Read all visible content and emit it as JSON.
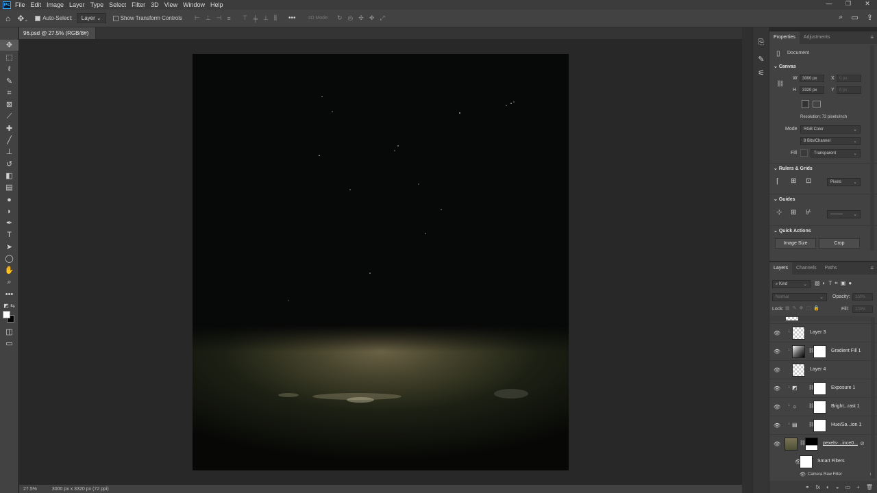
{
  "menubar": {
    "logo": "Ps",
    "items": [
      "File",
      "Edit",
      "Image",
      "Layer",
      "Type",
      "Select",
      "Filter",
      "3D",
      "View",
      "Window",
      "Help"
    ],
    "window_controls": [
      "—",
      "❐",
      "✕"
    ]
  },
  "options_bar": {
    "auto_select_label": "Auto-Select:",
    "auto_select_target": "Layer",
    "show_transform_label": "Show Transform Controls",
    "more": "•••",
    "three_d_mode": "3D Mode:"
  },
  "document": {
    "tab_title": "96.psd @ 27.5% (RGB/8#) *",
    "close": "×"
  },
  "status": {
    "zoom": "27.5%",
    "info": "3000 px x 3320 px (72 ppi)"
  },
  "properties": {
    "tabs": [
      "Properties",
      "Adjustments"
    ],
    "document_label": "Document",
    "canvas_header": "Canvas",
    "w_label": "W",
    "w_value": "3000 px",
    "h_label": "H",
    "h_value": "3320 px",
    "x_label": "X",
    "y_label": "Y",
    "x_value": "0 px",
    "y_value": "0 px",
    "resolution": "Resolution: 72 pixels/inch",
    "mode_label": "Mode",
    "mode_value": "RGB Color",
    "bits_value": "8 Bits/Channel",
    "fill_label": "Fill",
    "fill_value": "Transparent",
    "rulers_header": "Rulers & Grids",
    "units_value": "Pixels",
    "guides_header": "Guides",
    "quick_actions_header": "Quick Actions",
    "image_size_button": "Image Size",
    "crop_button": "Crop"
  },
  "layers_panel": {
    "tabs": [
      "Layers",
      "Channels",
      "Paths"
    ],
    "kind_label": "Kind",
    "blend_mode": "Normal",
    "opacity_label": "Opacity:",
    "opacity_value": "100%",
    "lock_label": "Lock:",
    "fill_label": "Fill:",
    "fill_value": "100%",
    "layers": [
      {
        "name": "Layer 3"
      },
      {
        "name": "Gradient Fill 1"
      },
      {
        "name": "Layer 4"
      },
      {
        "name": "Exposure 1"
      },
      {
        "name": "Bright...rast 1"
      },
      {
        "name": "Hue/Sa...ion 1"
      },
      {
        "name": "pexels-...ince0..."
      },
      {
        "name": "Smart Filters"
      },
      {
        "name": "Camera Raw Filter"
      }
    ],
    "footer_icons": [
      "⚭",
      "fx",
      "◐",
      "◒",
      "▭",
      "+",
      "🗑"
    ]
  }
}
